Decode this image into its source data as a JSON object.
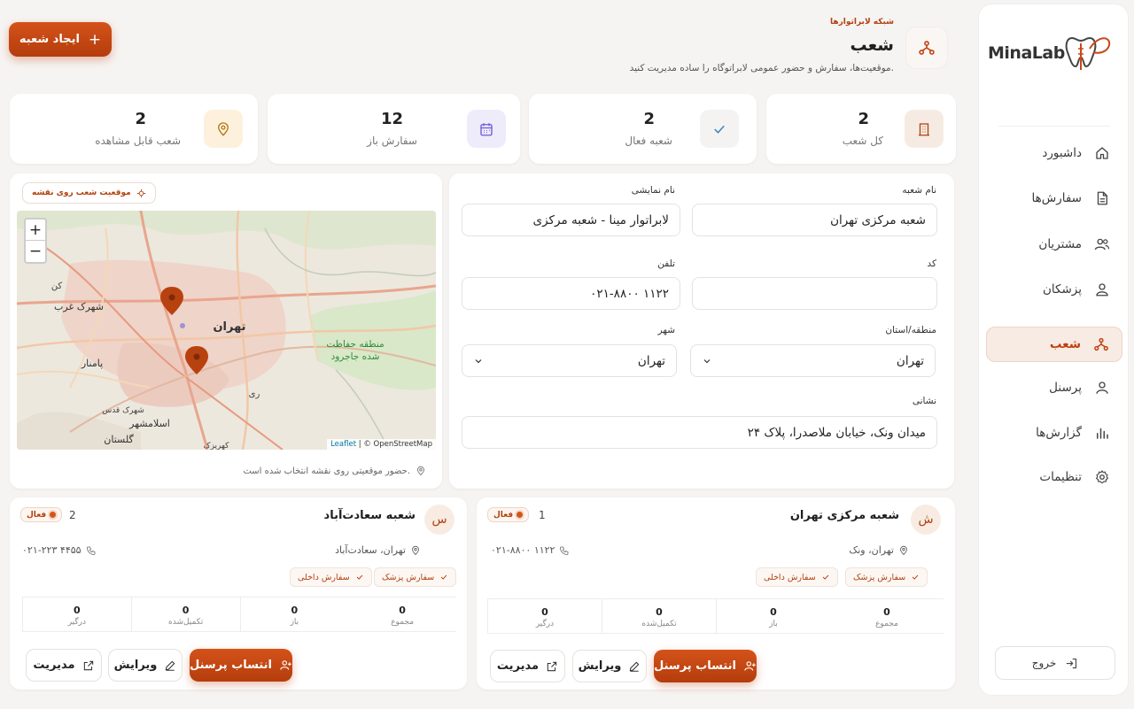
{
  "brand": {
    "logo_text": "MinaLab"
  },
  "sidebar": {
    "items": [
      {
        "label": "داشبورد",
        "icon": "home-icon"
      },
      {
        "label": "سفارش‌ها",
        "icon": "document-icon"
      },
      {
        "label": "مشتریان",
        "icon": "users-icon"
      },
      {
        "label": "پزشکان",
        "icon": "user-icon"
      },
      {
        "label": "شعب",
        "icon": "branches-icon",
        "active": true
      },
      {
        "label": "پرسنل",
        "icon": "person-icon"
      },
      {
        "label": "گزارش‌ها",
        "icon": "bar-chart-icon"
      },
      {
        "label": "تنظیمات",
        "icon": "gear-icon"
      }
    ],
    "logout": "خروج"
  },
  "header": {
    "breadcrumb": "شبکه لابراتوارها",
    "title": "شعب",
    "subtitle": "موقعیت‌ها، سفارش و حضور عمومی لابراتوگاه را ساده مدیریت کنید.",
    "create_button": "ایجاد شعبه"
  },
  "stats": [
    {
      "value": "2",
      "label": "کل شعب",
      "icon": "building-icon"
    },
    {
      "value": "2",
      "label": "شعبه فعال",
      "icon": "check-icon"
    },
    {
      "value": "12",
      "label": "سفارش باز",
      "icon": "calendar-icon"
    },
    {
      "value": "2",
      "label": "شعب قابل مشاهده",
      "icon": "location-pin-icon"
    }
  ],
  "map": {
    "chip": "موقعیت شعب روی نقشه",
    "zoom_in": "+",
    "zoom_out": "−",
    "attribution_leaflet": "Leaflet",
    "attribution_osm": "| © OpenStreetMap",
    "note": "حضور موقعیتی روی نقشه انتخاب شده است.",
    "labels": {
      "tehran": "تهران",
      "shahrak_gharb": "شهرک غرب",
      "pamenar": "پامنار",
      "eslamshahr": "اسلامشهر",
      "golestan": "گلستان",
      "protected_1": "منطقه حفاظت",
      "protected_2": "شده جاجرود",
      "kahrizak": "کهریزک",
      "shahriar": "شهرک قدس",
      "rey": "ری",
      "kan": "کن"
    }
  },
  "form": {
    "branch_name_label": "نام شعبه",
    "branch_name_value": "شعبه مرکزی تهران",
    "display_name_label": "نام نمایشی",
    "display_name_value": "لابراتوار مینا - شعبه مرکزی",
    "code_label": "کد",
    "code_value": "",
    "phone_label": "تلفن",
    "phone_value": "۰۲۱-۸۸۰۰ ۱۱۲۲",
    "region_label": "منطقه/استان",
    "region_value": "تهران",
    "city_label": "شهر",
    "city_value": "تهران",
    "address_label": "نشانی",
    "address_value": "میدان ونک، خیابان ملاصدرا، پلاک ۲۴"
  },
  "branches": [
    {
      "avatar": "ش",
      "name": "شعبه مرکزی تهران",
      "number": "1",
      "status": "فعال",
      "location": "تهران، ونک",
      "phone": "۰۲۱-۸۸۰۰ ۱۱۲۲",
      "tags": [
        "سفارش پزشک",
        "سفارش داخلی"
      ],
      "metrics": [
        {
          "value": "0",
          "label": "مجموع"
        },
        {
          "value": "0",
          "label": "باز"
        },
        {
          "value": "0",
          "label": "تکمیل‌شده"
        },
        {
          "value": "0",
          "label": "درگیر"
        }
      ],
      "assign": "انتساب پرسنل",
      "edit": "ویرایش",
      "manage": "مدیریت"
    },
    {
      "avatar": "س",
      "name": "شعبه سعادت‌آباد",
      "number": "2",
      "status": "فعال",
      "location": "تهران، سعادت‌آباد",
      "phone": "۰۲۱-۲۲۳ ۴۴۵۵",
      "tags": [
        "سفارش پزشک",
        "سفارش داخلی"
      ],
      "metrics": [
        {
          "value": "0",
          "label": "مجموع"
        },
        {
          "value": "0",
          "label": "باز"
        },
        {
          "value": "0",
          "label": "تکمیل‌شده"
        },
        {
          "value": "0",
          "label": "درگیر"
        }
      ],
      "assign": "انتساب پرسنل",
      "edit": "ویرایش",
      "manage": "مدیریت"
    }
  ],
  "colors": {
    "accent": "#c8481a",
    "accent_light": "#f7ebe4",
    "background": "#f6f4f2"
  }
}
